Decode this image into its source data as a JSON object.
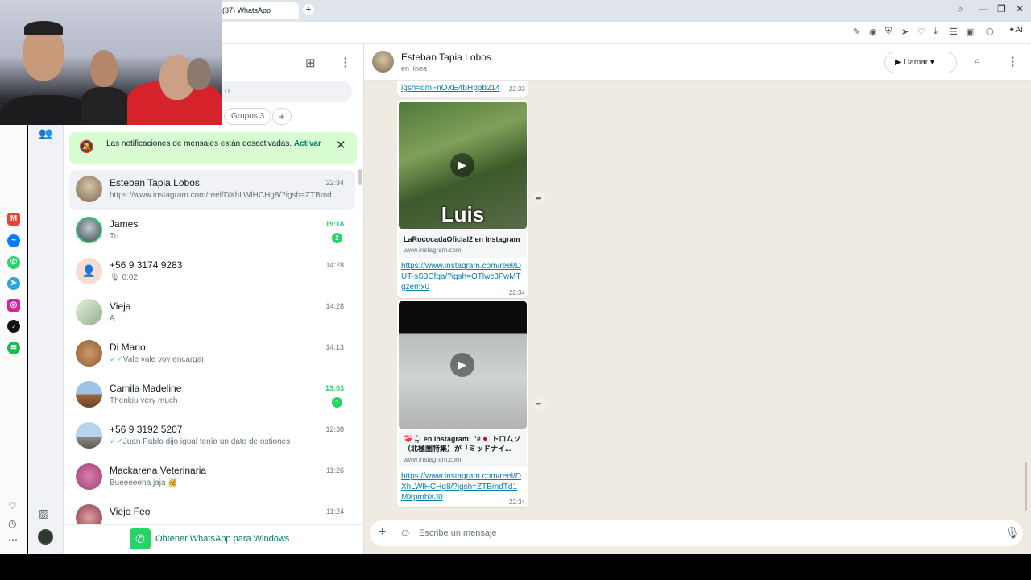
{
  "browser": {
    "tab_title": "(37) WhatsApp",
    "newtab_label": "+",
    "ai_label": "AI"
  },
  "sidebar_nav": {
    "rail_icons": [
      "gmail-icon",
      "messenger-icon",
      "whatsapp-icon",
      "telegram-icon",
      "instagram-icon",
      "tiktok-icon",
      "spotify-icon"
    ],
    "bottom_tools": [
      "heart-icon",
      "history-icon",
      "more-icon"
    ]
  },
  "chat_list": {
    "search_placeholder": "o",
    "chips": [
      {
        "label": "Grupos 3"
      }
    ],
    "notification": {
      "text": "Las notificaciones de mensajes están desactivadas.",
      "action": "Activar"
    },
    "chats": [
      {
        "name": "Esteban Tapia Lobos",
        "time": "22:34",
        "preview": "https://www.instagram.com/reel/DXhLWlHCHg8/?igsh=ZTBmdTd1...",
        "unread": "",
        "active": true
      },
      {
        "name": "James",
        "time": "19:18",
        "preview": "Tu",
        "unread": "2",
        "active": false
      },
      {
        "name": "+56 9 3174 9283",
        "time": "14:28",
        "preview": "0:02",
        "unread": "",
        "active": false
      },
      {
        "name": "Vieja",
        "time": "14:28",
        "preview": "A",
        "unread": "",
        "active": false
      },
      {
        "name": "Di Mario",
        "time": "14:13",
        "preview": "Vale vale voy encargar",
        "unread": "",
        "active": false
      },
      {
        "name": "Camila Madeline",
        "time": "13:03",
        "preview": "Thenkiu very much",
        "unread": "1",
        "active": false
      },
      {
        "name": "+56 9 3192 5207",
        "time": "12:38",
        "preview": "Juan Pablo dijo igual tenía un dato de ostiones",
        "unread": "",
        "active": false
      },
      {
        "name": "Mackarena Veterinaria",
        "time": "11:26",
        "preview": "Bueeeeena jaja 🥳",
        "unread": "",
        "active": false
      },
      {
        "name": "Viejo Feo",
        "time": "11:24",
        "preview": "",
        "unread": "",
        "active": false
      }
    ],
    "get_app": "Obtener WhatsApp para Windows"
  },
  "conversation": {
    "contact_name": "Esteban Tapia Lobos",
    "status": "en línea",
    "call_label": "Llamar",
    "messages": [
      {
        "link": "igsh=dmFnOXE4bHppb214",
        "time": "22:33"
      },
      {
        "thumb_caption": "Luis",
        "preview_title": "LaRococadaOficial2 en Instagram",
        "preview_domain": "www.instagram.com",
        "link": "https://www.instagram.com/reel/DUT-sS3Cfqa/?igsh=OTlwc3FwMTgzemx0",
        "time": "22:34"
      },
      {
        "preview_title": "❤️‍🩹🥋 en Instagram: \"#🇯🇵 トロムソ（北極圏特集）が「ミッドナイ...",
        "preview_domain": "www.instagram.com",
        "link": "https://www.instagram.com/reel/DXhLWlHCHg8/?igsh=ZTBmdTd1MXpmbXJ0",
        "time": "22:34"
      }
    ],
    "compose_placeholder": "Escribe un mensaje"
  },
  "colors": {
    "wa_green": "#25d366",
    "wa_dark_green": "#008069",
    "notif_bg": "#d9fdd3",
    "chat_bg": "#efeae2",
    "link": "#027eb5"
  }
}
